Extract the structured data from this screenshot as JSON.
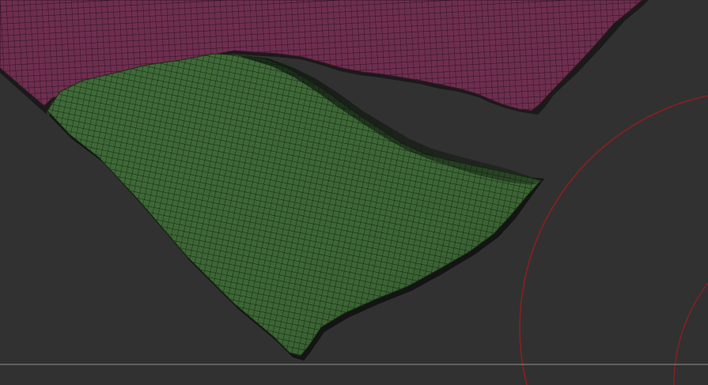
{
  "viewport": {
    "name": "3D viewport",
    "background": "#313131"
  },
  "meshes": [
    {
      "id": "magenta-mesh",
      "fill": "#6e2e4f",
      "wire": "#2a1220",
      "shadow": "#161616"
    },
    {
      "id": "green-mesh",
      "fill": "#3f6a38",
      "wire": "#15230f",
      "shadow": "#121212"
    }
  ],
  "gizmo": {
    "ring_color": "#8c1f1f"
  },
  "ground_line": {
    "color": "#8f8f8f"
  }
}
